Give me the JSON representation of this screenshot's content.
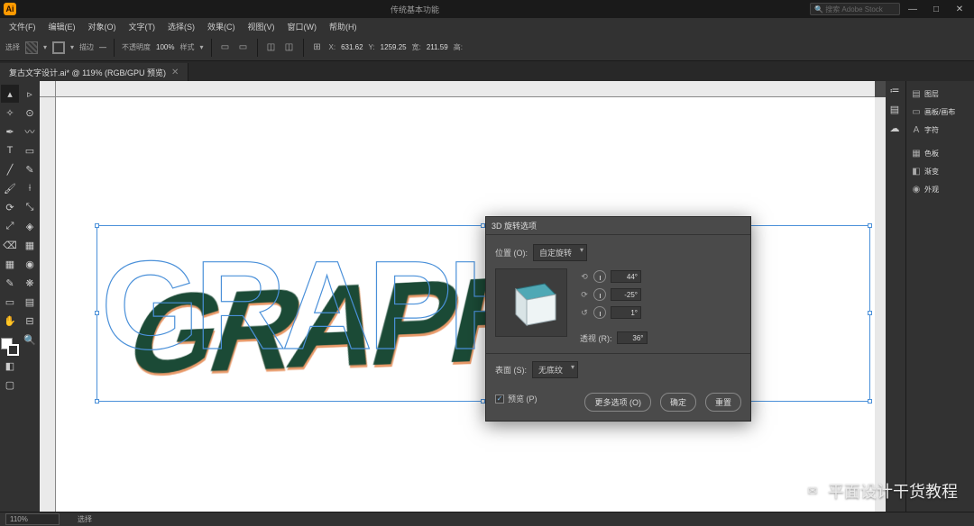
{
  "app": {
    "logo": "Ai",
    "title": "传统基本功能",
    "search_placeholder": "搜索 Adobe Stock"
  },
  "menu": [
    "文件(F)",
    "编辑(E)",
    "对象(O)",
    "文字(T)",
    "选择(S)",
    "效果(C)",
    "视图(V)",
    "窗口(W)",
    "帮助(H)"
  ],
  "ctrlbar": {
    "label_sel": "选择",
    "stroke_label": "描边",
    "stroke_val": "—",
    "opacity_label": "不透明度",
    "opacity_val": "100%",
    "style_label": "样式",
    "x_label": "X:",
    "x_val": "631.62",
    "y_label": "Y:",
    "y_val": "1259.25",
    "w_label": "宽:",
    "w_val": "211.59",
    "h_label": "高:"
  },
  "tab": {
    "name": "复古文字设计.ai* @ 119% (RGB/GPU 预览)"
  },
  "panels": [
    "图层",
    "画板/画布",
    "字符",
    "色板",
    "渐变",
    "外观"
  ],
  "zoom": "110%",
  "status_sel": "选择",
  "graphic_text": "GRAPHIC",
  "dialog": {
    "title": "3D 旋转选项",
    "pos_label": "位置 (O):",
    "pos_val": "自定旋转",
    "rotX": "44°",
    "rotY": "-25°",
    "rotZ": "1°",
    "persp_label": "透视 (R):",
    "persp_val": "36°",
    "surface_label": "表面 (S):",
    "surface_val": "无底纹",
    "preview": "预览 (P)",
    "btn_more": "更多选项 (O)",
    "btn_ok": "确定",
    "btn_reset": "重置"
  },
  "watermark": "平面设计干货教程"
}
